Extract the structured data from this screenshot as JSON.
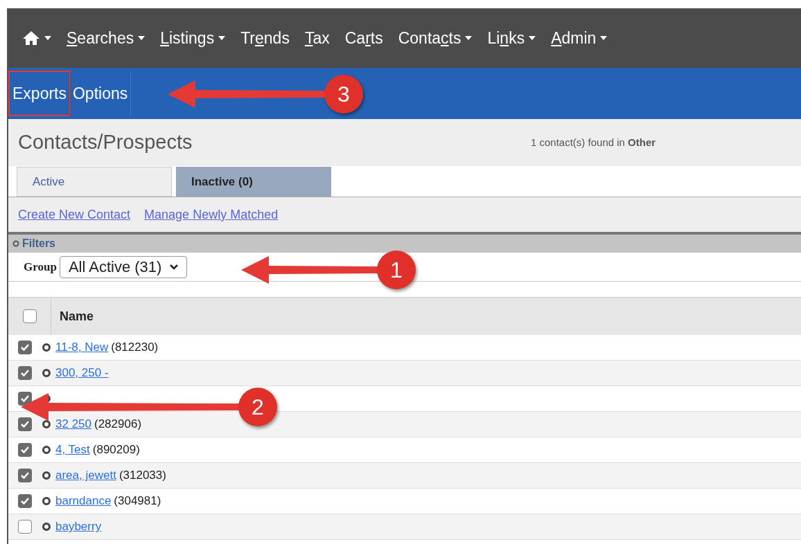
{
  "menu": [
    {
      "kind": "home",
      "caret": true
    },
    {
      "kind": "text",
      "label_parts": [
        {
          "text": "S",
          "underlined": true
        },
        {
          "text": "earches",
          "underlined": false
        }
      ],
      "caret": true
    },
    {
      "kind": "text",
      "label_parts": [
        {
          "text": "L",
          "underlined": true
        },
        {
          "text": "istings",
          "underlined": false
        }
      ],
      "caret": true
    },
    {
      "kind": "text",
      "label_parts": [
        {
          "text": "Tr",
          "underlined": false
        },
        {
          "text": "e",
          "underlined": true
        },
        {
          "text": "nds",
          "underlined": false
        }
      ],
      "caret": false
    },
    {
      "kind": "text",
      "label_parts": [
        {
          "text": "T",
          "underlined": true
        },
        {
          "text": "ax",
          "underlined": false
        }
      ],
      "caret": false
    },
    {
      "kind": "text",
      "label_parts": [
        {
          "text": "Ca",
          "underlined": false
        },
        {
          "text": "r",
          "underlined": true
        },
        {
          "text": "ts",
          "underlined": false
        }
      ],
      "caret": false
    },
    {
      "kind": "text",
      "label_parts": [
        {
          "text": "Conta",
          "underlined": false
        },
        {
          "text": "c",
          "underlined": true
        },
        {
          "text": "ts",
          "underlined": false
        }
      ],
      "caret": true
    },
    {
      "kind": "text",
      "label_parts": [
        {
          "text": "Li",
          "underlined": false
        },
        {
          "text": "n",
          "underlined": true
        },
        {
          "text": "ks",
          "underlined": false
        }
      ],
      "caret": true
    },
    {
      "kind": "text",
      "label_parts": [
        {
          "text": "A",
          "underlined": true
        },
        {
          "text": "dmin",
          "underlined": false
        }
      ],
      "caret": true
    }
  ],
  "subnav": [
    {
      "label": "Exports",
      "highlighted": true
    },
    {
      "label": "Options",
      "highlighted": false
    }
  ],
  "page": {
    "title": "Contacts/Prospects",
    "summary": "1 contact(s) found in **Other**"
  },
  "tabs": [
    {
      "label": "Active",
      "selected": true
    },
    {
      "label": "Inactive (0)",
      "selected": false
    }
  ],
  "actions": [
    "Create New Contact",
    "Manage Newly Matched"
  ],
  "filters": {
    "title": "Filters",
    "group_label": "Group",
    "group_value": "All Active (31)"
  },
  "table": {
    "select_all": false,
    "columns": [
      "Name"
    ],
    "rows": [
      {
        "checked": true,
        "name": "11-8, New",
        "id": "(812230)"
      },
      {
        "checked": true,
        "name": "300, 250 -"
      },
      {
        "checked": true
      },
      {
        "checked": true,
        "name": "32 250",
        "id": "(282906)"
      },
      {
        "checked": true,
        "name": "4, Test",
        "id": "(890209)"
      },
      {
        "checked": true,
        "name": "area, jewett",
        "id": "(312033)"
      },
      {
        "checked": true,
        "name": "barndance",
        "id": "(304981)"
      },
      {
        "checked": false,
        "name": "bayberry"
      }
    ]
  },
  "callouts": [
    {
      "number": "3"
    },
    {
      "number": "1"
    },
    {
      "number": "2"
    }
  ]
}
